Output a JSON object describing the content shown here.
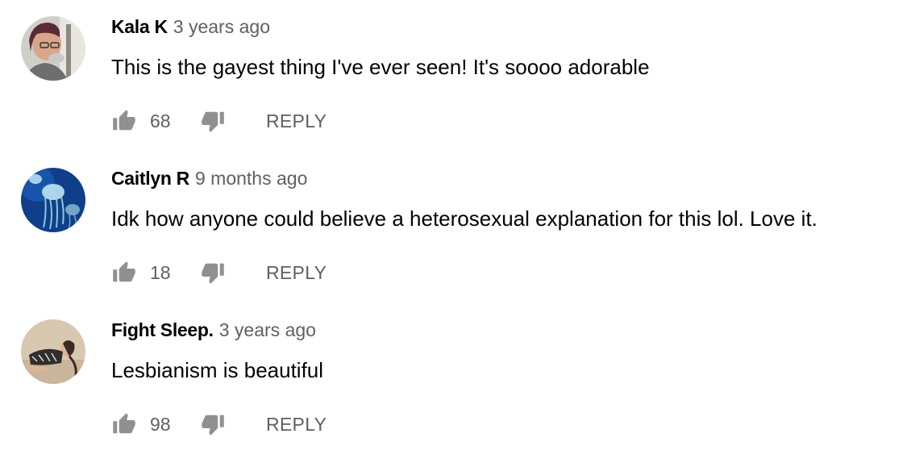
{
  "comments": [
    {
      "author": "Kala K",
      "time": "3 years ago",
      "text": "This is the gayest thing I've ever seen! It's soooo adorable",
      "likes": "68",
      "reply_label": "REPLY",
      "avatar": "person-with-glasses-avatar"
    },
    {
      "author": "Caitlyn R",
      "time": "9 months ago",
      "text": "Idk how anyone could believe a heterosexual explanation for this lol. Love it.",
      "likes": "18",
      "reply_label": "REPLY",
      "avatar": "jellyfish-avatar"
    },
    {
      "author": "Fight Sleep.",
      "time": "3 years ago",
      "text": "Lesbianism is beautiful",
      "likes": "98",
      "reply_label": "REPLY",
      "avatar": "reclining-person-avatar"
    }
  ],
  "colors": {
    "author": "#030303",
    "meta": "#606060",
    "icon": "#909090"
  }
}
